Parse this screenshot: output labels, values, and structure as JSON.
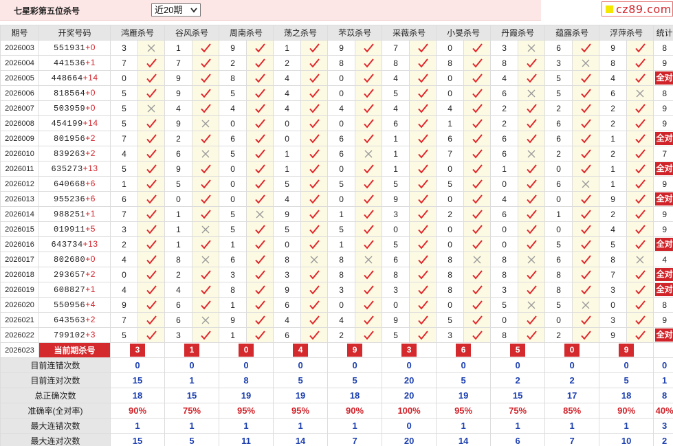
{
  "header": {
    "title": "七星彩第五位杀号",
    "period_selected": "近20期",
    "logo_text": "cz89.com"
  },
  "columns": [
    "期号",
    "开奖号码",
    "鸿雁杀号",
    "谷风杀号",
    "周南杀号",
    "荡之杀号",
    "芣苡杀号",
    "采薇杀号",
    "小旻杀号",
    "丹霞杀号",
    "蕴露杀号",
    "浮萍杀号",
    "统计"
  ],
  "rows": [
    {
      "issue": "2026003",
      "draw": "551931",
      "plus": "+0",
      "kills": [
        "3",
        "1",
        "9",
        "1",
        "9",
        "7",
        "0",
        "3",
        "6",
        "9"
      ],
      "marks": [
        "x",
        "v",
        "v",
        "v",
        "v",
        "v",
        "v",
        "x",
        "v",
        "v"
      ],
      "stat": "8"
    },
    {
      "issue": "2026004",
      "draw": "441536",
      "plus": "+1",
      "kills": [
        "7",
        "7",
        "2",
        "2",
        "8",
        "8",
        "8",
        "8",
        "3",
        "8"
      ],
      "marks": [
        "v",
        "v",
        "v",
        "v",
        "v",
        "v",
        "v",
        "v",
        "x",
        "v"
      ],
      "stat": "9"
    },
    {
      "issue": "2026005",
      "draw": "448664",
      "plus": "+14",
      "kills": [
        "0",
        "9",
        "8",
        "4",
        "0",
        "4",
        "0",
        "4",
        "5",
        "4"
      ],
      "marks": [
        "v",
        "v",
        "v",
        "v",
        "v",
        "v",
        "v",
        "v",
        "v",
        "v"
      ],
      "stat": "全对"
    },
    {
      "issue": "2026006",
      "draw": "818564",
      "plus": "+0",
      "kills": [
        "5",
        "9",
        "5",
        "4",
        "0",
        "5",
        "0",
        "6",
        "5",
        "6"
      ],
      "marks": [
        "v",
        "v",
        "v",
        "v",
        "v",
        "v",
        "v",
        "x",
        "v",
        "x"
      ],
      "stat": "8"
    },
    {
      "issue": "2026007",
      "draw": "503959",
      "plus": "+0",
      "kills": [
        "5",
        "4",
        "4",
        "4",
        "4",
        "4",
        "4",
        "2",
        "2",
        "2"
      ],
      "marks": [
        "x",
        "v",
        "v",
        "v",
        "v",
        "v",
        "v",
        "v",
        "v",
        "v"
      ],
      "stat": "9"
    },
    {
      "issue": "2026008",
      "draw": "454199",
      "plus": "+14",
      "kills": [
        "5",
        "9",
        "0",
        "0",
        "0",
        "6",
        "1",
        "2",
        "6",
        "2"
      ],
      "marks": [
        "v",
        "x",
        "v",
        "v",
        "v",
        "v",
        "v",
        "v",
        "v",
        "v"
      ],
      "stat": "9"
    },
    {
      "issue": "2026009",
      "draw": "801956",
      "plus": "+2",
      "kills": [
        "7",
        "2",
        "6",
        "0",
        "6",
        "1",
        "6",
        "6",
        "6",
        "1"
      ],
      "marks": [
        "v",
        "v",
        "v",
        "v",
        "v",
        "v",
        "v",
        "v",
        "v",
        "v"
      ],
      "stat": "全对"
    },
    {
      "issue": "2026010",
      "draw": "839263",
      "plus": "+2",
      "kills": [
        "4",
        "6",
        "5",
        "1",
        "6",
        "1",
        "7",
        "6",
        "2",
        "2"
      ],
      "marks": [
        "v",
        "x",
        "v",
        "v",
        "x",
        "v",
        "v",
        "x",
        "v",
        "v"
      ],
      "stat": "7"
    },
    {
      "issue": "2026011",
      "draw": "635273",
      "plus": "+13",
      "kills": [
        "5",
        "9",
        "0",
        "1",
        "0",
        "1",
        "0",
        "1",
        "0",
        "1"
      ],
      "marks": [
        "v",
        "v",
        "v",
        "v",
        "v",
        "v",
        "v",
        "v",
        "v",
        "v"
      ],
      "stat": "全对"
    },
    {
      "issue": "2026012",
      "draw": "640668",
      "plus": "+6",
      "kills": [
        "1",
        "5",
        "0",
        "5",
        "5",
        "5",
        "5",
        "0",
        "6",
        "1"
      ],
      "marks": [
        "v",
        "v",
        "v",
        "v",
        "v",
        "v",
        "v",
        "v",
        "x",
        "v"
      ],
      "stat": "9"
    },
    {
      "issue": "2026013",
      "draw": "955236",
      "plus": "+6",
      "kills": [
        "6",
        "0",
        "0",
        "4",
        "0",
        "9",
        "0",
        "4",
        "0",
        "9"
      ],
      "marks": [
        "v",
        "v",
        "v",
        "v",
        "v",
        "v",
        "v",
        "v",
        "v",
        "v"
      ],
      "stat": "全对"
    },
    {
      "issue": "2026014",
      "draw": "988251",
      "plus": "+1",
      "kills": [
        "7",
        "1",
        "5",
        "9",
        "1",
        "3",
        "2",
        "6",
        "1",
        "2"
      ],
      "marks": [
        "v",
        "v",
        "x",
        "v",
        "v",
        "v",
        "v",
        "v",
        "v",
        "v"
      ],
      "stat": "9"
    },
    {
      "issue": "2026015",
      "draw": "019911",
      "plus": "+5",
      "kills": [
        "3",
        "1",
        "5",
        "5",
        "5",
        "0",
        "0",
        "0",
        "0",
        "4"
      ],
      "marks": [
        "v",
        "x",
        "v",
        "v",
        "v",
        "v",
        "v",
        "v",
        "v",
        "v"
      ],
      "stat": "9"
    },
    {
      "issue": "2026016",
      "draw": "643734",
      "plus": "+13",
      "kills": [
        "2",
        "1",
        "1",
        "0",
        "1",
        "5",
        "0",
        "0",
        "5",
        "5"
      ],
      "marks": [
        "v",
        "v",
        "v",
        "v",
        "v",
        "v",
        "v",
        "v",
        "v",
        "v"
      ],
      "stat": "全对"
    },
    {
      "issue": "2026017",
      "draw": "802680",
      "plus": "+0",
      "kills": [
        "4",
        "8",
        "6",
        "8",
        "8",
        "6",
        "8",
        "8",
        "6",
        "8"
      ],
      "marks": [
        "v",
        "x",
        "v",
        "x",
        "x",
        "v",
        "x",
        "x",
        "v",
        "x"
      ],
      "stat": "4"
    },
    {
      "issue": "2026018",
      "draw": "293657",
      "plus": "+2",
      "kills": [
        "0",
        "2",
        "3",
        "3",
        "8",
        "8",
        "8",
        "8",
        "8",
        "7"
      ],
      "marks": [
        "v",
        "v",
        "v",
        "v",
        "v",
        "v",
        "v",
        "v",
        "v",
        "v"
      ],
      "stat": "全对"
    },
    {
      "issue": "2026019",
      "draw": "608827",
      "plus": "+1",
      "kills": [
        "4",
        "4",
        "8",
        "9",
        "3",
        "3",
        "8",
        "3",
        "8",
        "3"
      ],
      "marks": [
        "v",
        "v",
        "v",
        "v",
        "v",
        "v",
        "v",
        "v",
        "v",
        "v"
      ],
      "stat": "全对"
    },
    {
      "issue": "2026020",
      "draw": "550956",
      "plus": "+4",
      "kills": [
        "9",
        "6",
        "1",
        "6",
        "0",
        "0",
        "0",
        "5",
        "5",
        "0"
      ],
      "marks": [
        "v",
        "v",
        "v",
        "v",
        "v",
        "v",
        "v",
        "x",
        "x",
        "v"
      ],
      "stat": "8"
    },
    {
      "issue": "2026021",
      "draw": "643563",
      "plus": "+2",
      "kills": [
        "7",
        "6",
        "9",
        "4",
        "4",
        "9",
        "5",
        "0",
        "0",
        "3"
      ],
      "marks": [
        "v",
        "x",
        "v",
        "v",
        "v",
        "v",
        "v",
        "v",
        "v",
        "v"
      ],
      "stat": "9"
    },
    {
      "issue": "2026022",
      "draw": "799102",
      "plus": "+3",
      "kills": [
        "5",
        "3",
        "1",
        "6",
        "2",
        "5",
        "3",
        "8",
        "2",
        "9"
      ],
      "marks": [
        "v",
        "v",
        "v",
        "v",
        "v",
        "v",
        "v",
        "v",
        "v",
        "v"
      ],
      "stat": "全对"
    }
  ],
  "current": {
    "issue": "2026023",
    "label": "当前期杀号",
    "kills": [
      "3",
      "1",
      "0",
      "4",
      "9",
      "3",
      "6",
      "5",
      "0",
      "9"
    ]
  },
  "summary": [
    {
      "label": "目前连错次数",
      "values": [
        "0",
        "0",
        "0",
        "0",
        "0",
        "0",
        "0",
        "0",
        "0",
        "0",
        "0"
      ],
      "color": "blue"
    },
    {
      "label": "目前连对次数",
      "values": [
        "15",
        "1",
        "8",
        "5",
        "5",
        "20",
        "5",
        "2",
        "2",
        "5",
        "1"
      ],
      "color": "blue"
    },
    {
      "label": "总正确次数",
      "values": [
        "18",
        "15",
        "19",
        "19",
        "18",
        "20",
        "19",
        "15",
        "17",
        "18",
        "8"
      ],
      "color": "blue"
    },
    {
      "label": "准确率(全对率)",
      "values": [
        "90%",
        "75%",
        "95%",
        "95%",
        "90%",
        "100%",
        "95%",
        "75%",
        "85%",
        "90%",
        "40%"
      ],
      "color": "red"
    },
    {
      "label": "最大连错次数",
      "values": [
        "1",
        "1",
        "1",
        "1",
        "1",
        "0",
        "1",
        "1",
        "1",
        "1",
        "3"
      ],
      "color": "blue"
    },
    {
      "label": "最大连对次数",
      "values": [
        "15",
        "5",
        "11",
        "14",
        "7",
        "20",
        "14",
        "6",
        "7",
        "10",
        "2"
      ],
      "color": "blue"
    }
  ],
  "icons": {
    "correct": "check-icon",
    "wrong": "cross-icon",
    "check_color": "#e0262b",
    "cross_color": "#999999"
  }
}
